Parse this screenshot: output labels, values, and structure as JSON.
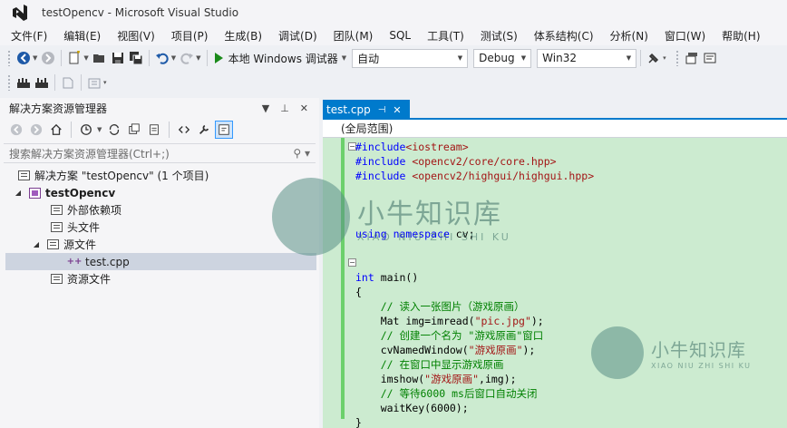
{
  "window": {
    "title": "testOpencv - Microsoft Visual Studio"
  },
  "menu": [
    "文件(F)",
    "编辑(E)",
    "视图(V)",
    "项目(P)",
    "生成(B)",
    "调试(D)",
    "团队(M)",
    "SQL",
    "工具(T)",
    "测试(S)",
    "体系结构(C)",
    "分析(N)",
    "窗口(W)",
    "帮助(H)"
  ],
  "toolbar": {
    "run_label": "本地 Windows 调试器",
    "dropdowns": {
      "auto": "自动",
      "config": "Debug",
      "platform": "Win32"
    }
  },
  "solution_explorer": {
    "title": "解决方案资源管理器",
    "search_placeholder": "搜索解决方案资源管理器(Ctrl+;)",
    "tree": [
      {
        "label": "解决方案 \"testOpencv\" (1 个项目)"
      },
      {
        "label": "testOpencv"
      },
      {
        "label": "外部依赖项"
      },
      {
        "label": "头文件"
      },
      {
        "label": "源文件"
      },
      {
        "label": "test.cpp"
      },
      {
        "label": "资源文件"
      }
    ]
  },
  "editor": {
    "tab": "test.cpp",
    "scope": "(全局范围)",
    "code": {
      "inc1_dir": "#include",
      "inc1_file": "<iostream>",
      "inc2_dir": "#include",
      "inc2_file": "<opencv2/core/core.hpp>",
      "inc3_dir": "#include",
      "inc3_file": "<opencv2/highgui/highgui.hpp>",
      "using_kw": "using",
      "namespace_kw": "namespace",
      "using_rest": " cv;",
      "int_kw": "int",
      "main_rest": " main()",
      "open_brace": "{",
      "c1": "// 读入一张图片（游戏原画）",
      "l1_pre": "Mat img=imread(",
      "l1_str": "\"pic.jpg\"",
      "l1_post": ");",
      "c2": "// 创建一个名为 \"游戏原画\"窗口",
      "l2_pre": "cvNamedWindow(",
      "l2_str": "\"游戏原画\"",
      "l2_post": ");",
      "c3": "// 在窗口中显示游戏原画",
      "l3_pre": "imshow(",
      "l3_str": "\"游戏原画\"",
      "l3_post": ",img);",
      "c4": "// 等待6000 ms后窗口自动关闭",
      "l4": "waitKey(6000);",
      "close_brace": "}"
    }
  },
  "watermark": {
    "cn": "小牛知识库",
    "en": "XIAO NIU ZHI SHI KU"
  }
}
